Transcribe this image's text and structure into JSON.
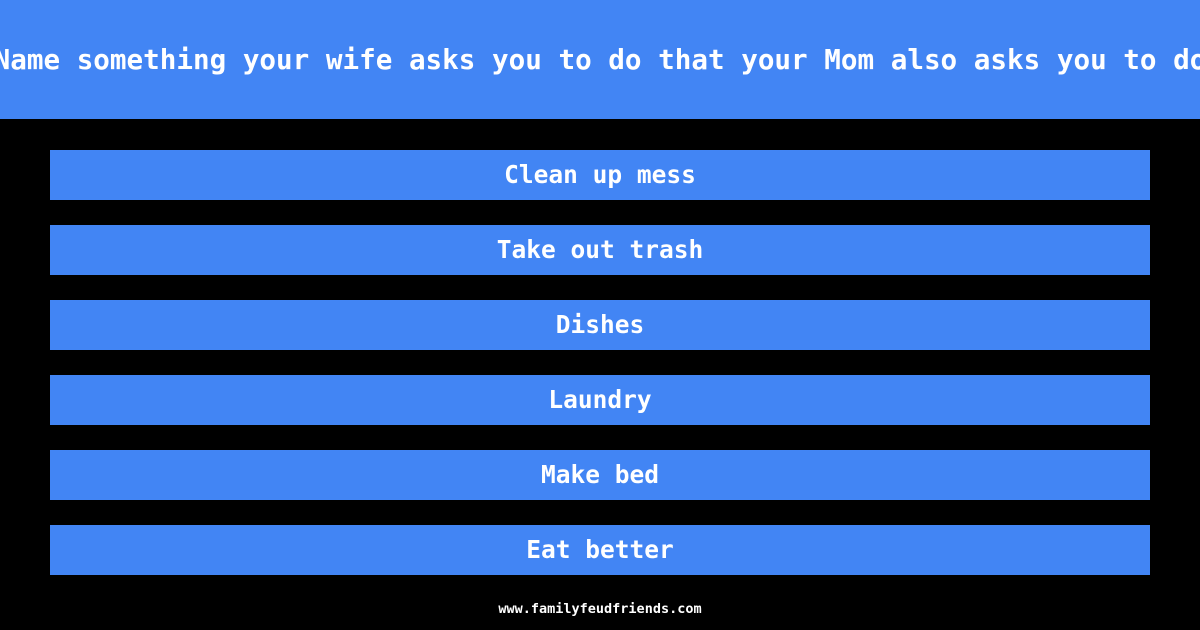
{
  "page": {
    "background_color": "#000000",
    "accent_color": "#4285F4",
    "text_color": "#FFFFFF"
  },
  "header": {
    "question": "Name something your wife asks you to do that your Mom also asks you to do"
  },
  "answers": [
    {
      "text": "Clean up mess"
    },
    {
      "text": "Take out trash"
    },
    {
      "text": "Dishes"
    },
    {
      "text": "Laundry"
    },
    {
      "text": "Make bed"
    },
    {
      "text": "Eat better"
    }
  ],
  "footer": {
    "site": "www.familyfeudfriends.com"
  }
}
